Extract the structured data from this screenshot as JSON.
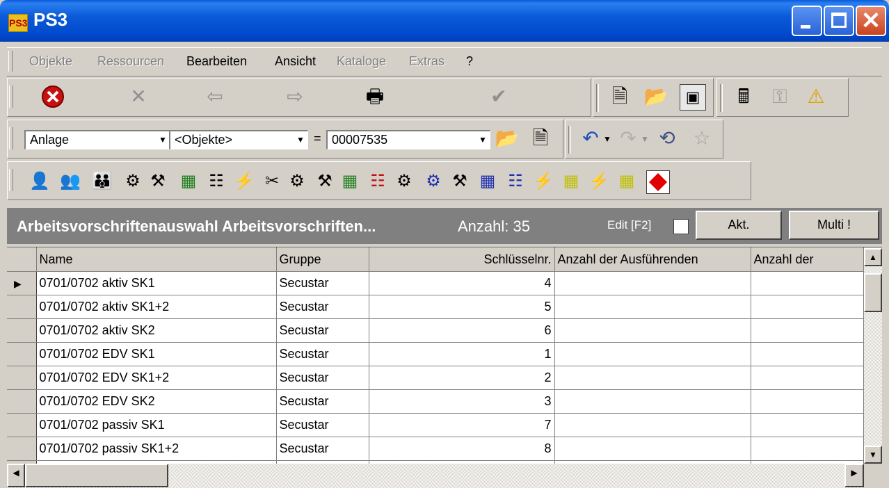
{
  "window": {
    "title": "PS3",
    "app_icon": "PS3"
  },
  "menu": {
    "items": [
      {
        "label": "Objekte",
        "enabled": false
      },
      {
        "label": "Ressourcen",
        "enabled": false
      },
      {
        "label": "Bearbeiten",
        "enabled": true
      },
      {
        "label": "Ansicht",
        "enabled": true
      },
      {
        "label": "Kataloge",
        "enabled": false
      },
      {
        "label": "Extras",
        "enabled": false
      },
      {
        "label": "?",
        "enabled": true
      }
    ]
  },
  "toolbar2": {
    "combo1": "Anlage",
    "combo2": "<Objekte>",
    "equals": "=",
    "combo3": "00007535"
  },
  "panel": {
    "title": "Arbeitsvorschriftenauswahl Arbeitsvorschriften...",
    "count": "Anzahl: 35",
    "edit_label": "Edit [F2]",
    "akt_button": "Akt.",
    "multi_button": "Multi !"
  },
  "grid": {
    "columns": [
      "Name",
      "Gruppe",
      "Schlüsselnr.",
      "Anzahl der Ausführenden",
      "Anzahl der"
    ],
    "rows": [
      {
        "name": "0701/0702 aktiv SK1",
        "gruppe": "Secustar",
        "nr": "4"
      },
      {
        "name": "0701/0702 aktiv SK1+2",
        "gruppe": "Secustar",
        "nr": "5"
      },
      {
        "name": "0701/0702 aktiv SK2",
        "gruppe": "Secustar",
        "nr": "6"
      },
      {
        "name": "0701/0702 EDV SK1",
        "gruppe": "Secustar",
        "nr": "1"
      },
      {
        "name": "0701/0702 EDV SK1+2",
        "gruppe": "Secustar",
        "nr": "2"
      },
      {
        "name": "0701/0702 EDV SK2",
        "gruppe": "Secustar",
        "nr": "3"
      },
      {
        "name": "0701/0702 passiv SK1",
        "gruppe": "Secustar",
        "nr": "7"
      },
      {
        "name": "0701/0702 passiv SK1+2",
        "gruppe": "Secustar",
        "nr": "8"
      }
    ]
  },
  "colors": {
    "titlebar": "#0a5ad8",
    "panel_header": "#808080",
    "face": "#d4d0c8"
  }
}
